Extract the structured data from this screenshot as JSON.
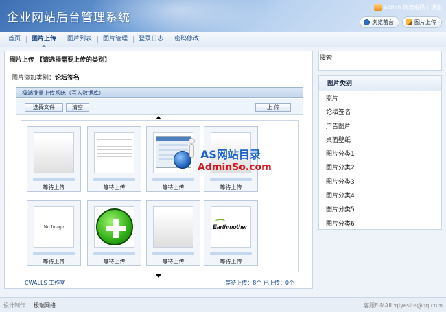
{
  "header": {
    "app_title": "企业网站后台管理系统",
    "user": "admin",
    "change_password": "修改密码",
    "logout": "退出",
    "preview_button": "浏览前台",
    "upload_button": "图片上传"
  },
  "nav": {
    "items": [
      {
        "label": "首页",
        "active": false
      },
      {
        "label": "图片上传",
        "active": true
      },
      {
        "label": "图片列表",
        "active": false
      },
      {
        "label": "图片管理",
        "active": false
      },
      {
        "label": "登录日志",
        "active": false
      },
      {
        "label": "密码修改",
        "active": false
      }
    ]
  },
  "main": {
    "title": "图片上传",
    "title_hint": "【请选择需要上传的类别】",
    "category_label": "图片添加类别：",
    "category_value": "论坛签名"
  },
  "uploader": {
    "header": "极端批量上传系统（写入数据库）",
    "select_files": "选择文件",
    "clear": "清空",
    "upload": "上 传",
    "tiles": [
      {
        "status": "等待上传",
        "thumb": "blank"
      },
      {
        "status": "等待上传",
        "thumb": "icons-sheet"
      },
      {
        "status": "等待上传",
        "thumb": "screenshot"
      },
      {
        "status": "等待上传",
        "thumb": "blank"
      },
      {
        "status": "等待上传",
        "thumb": "no-image",
        "text": "No Image"
      },
      {
        "status": "等待上传",
        "thumb": "green-plus"
      },
      {
        "status": "等待上传",
        "thumb": "blank"
      },
      {
        "status": "等待上传",
        "thumb": "logo",
        "text": "Earthmother"
      }
    ],
    "footer_left": "CWALLS 工作室",
    "footer_right": "等待上传：8个   已上传：0个"
  },
  "watermark": {
    "line1": "AS网站目录",
    "line2": "AdminSo.com"
  },
  "sidebar": {
    "search_label": "搜索",
    "category_title": "图片类别",
    "categories": [
      "照片",
      "论坛签名",
      "广告图片",
      "桌面壁纸",
      "图片分类1",
      "图片分类2",
      "图片分类3",
      "图片分类4",
      "图片分类5",
      "图片分类6"
    ]
  },
  "footer": {
    "design_label": "设计制作：",
    "design_value": "极端网络",
    "contact": "客服E-MAIL:qiyesite@qq.com"
  },
  "colors": {
    "header_start": "#3d6fb3",
    "nav_text": "#1d4d8c",
    "panel_border": "#c9d6e6",
    "watermark_blue": "#1b63c9",
    "watermark_red": "#d4191f"
  }
}
